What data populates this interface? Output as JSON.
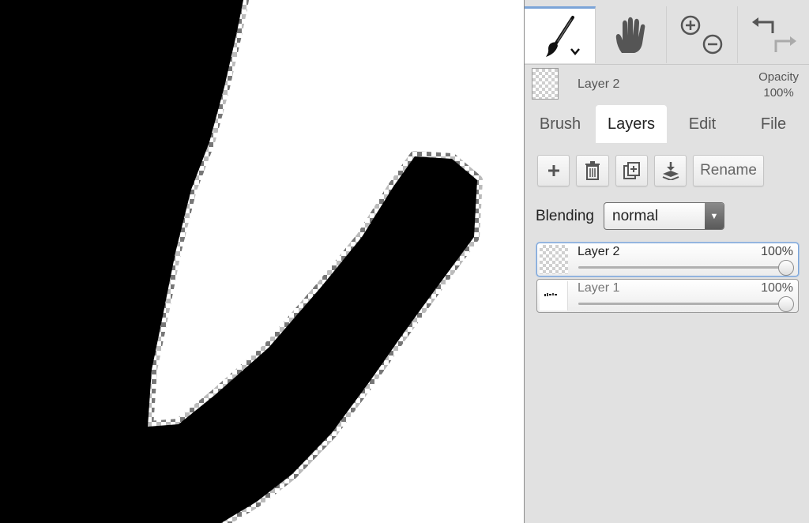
{
  "toolbar": {
    "tools": [
      {
        "name": "brush-tool",
        "icon": "brush-icon",
        "active": true
      },
      {
        "name": "hand-tool",
        "icon": "hand-icon"
      },
      {
        "name": "zoom-tool",
        "icon": "zoom-in-out-icon"
      },
      {
        "name": "undo-redo-tool",
        "icon": "undo-redo-icon"
      }
    ]
  },
  "current_layer": {
    "name": "Layer 2",
    "opacity_label": "Opacity",
    "opacity_value": "100%"
  },
  "tabs": [
    {
      "label": "Brush"
    },
    {
      "label": "Layers",
      "active": true
    },
    {
      "label": "Edit"
    },
    {
      "label": "File"
    }
  ],
  "layers_panel": {
    "buttons": {
      "add_icon": "plus-icon",
      "delete_icon": "trash-icon",
      "duplicate_icon": "duplicate-icon",
      "merge_icon": "merge-down-icon",
      "rename_label": "Rename"
    },
    "blending_label": "Blending",
    "blending_value": "normal",
    "layers": [
      {
        "name": "Layer 2",
        "opacity": "100%",
        "opacity_fraction": 1.0,
        "selected": true
      },
      {
        "name": "Layer 1",
        "opacity": "100%",
        "opacity_fraction": 1.0,
        "selected": false
      }
    ]
  },
  "colors": {
    "accent": "#7ba4d8",
    "panel_bg": "#e1e1e1",
    "stroke": "#000000"
  }
}
